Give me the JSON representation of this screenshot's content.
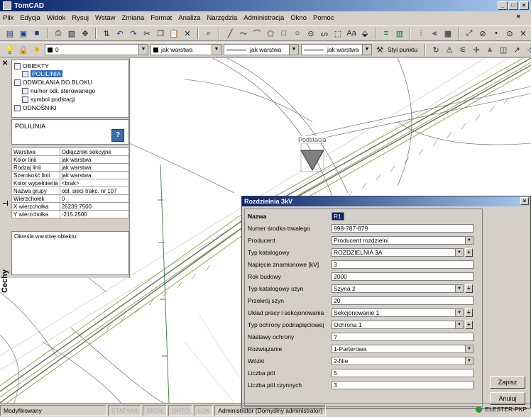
{
  "app": {
    "title": "TomCAD"
  },
  "window_buttons": {
    "minimize": "_",
    "maximize": "□",
    "close": "×"
  },
  "menu": [
    "Plik",
    "Edycja",
    "Widok",
    "Rysuj",
    "Wstaw",
    "Zmiana",
    "Format",
    "Analiza",
    "Narzędzia",
    "Administracja",
    "Okno",
    "Pomoc"
  ],
  "menu_close": "×",
  "toolbar2": {
    "layer_value": "0",
    "color_value": "jak warstwa",
    "linetype_value": "jak warstwa",
    "lineweight_value": "jak warstwa",
    "point_style_label": "Styl punktu"
  },
  "tree": {
    "obiekty": "OBIEKTY",
    "polilinia": "POLILINIA",
    "odwolania": "ODWOŁANIA DO BLOKU",
    "numer": "numer odł. sterowanego",
    "symbol": "symbol podstacji",
    "odnosniki": "ODNOŚNIKI"
  },
  "properties": {
    "object_type": "POLILINIA",
    "help": "?",
    "rows": [
      {
        "key": "Warstwa",
        "value": "Odłączniki sekcyjne"
      },
      {
        "key": "Kolor linii",
        "value": "jak warstwa"
      },
      {
        "key": "Rodzaj linii",
        "value": "jak warstwa"
      },
      {
        "key": "Szerokość linii",
        "value": "jak warstwa"
      },
      {
        "key": "Kolor wypełnienia",
        "value": "<brak>"
      },
      {
        "key": "Nazwa grupy",
        "value": "odł. sieci trakc. nr 107"
      },
      {
        "key": "Wierzchołek",
        "value": "0"
      },
      {
        "key": "X wierzchołka",
        "value": "26239.7500"
      },
      {
        "key": "Y wierzchołka",
        "value": "-215.2500"
      }
    ],
    "description": "Określa warstwę obiektu",
    "pin": "⊣",
    "tab_label": "Cechy"
  },
  "drawing": {
    "substation_label": "Podstacja"
  },
  "dialog": {
    "title": "Rozdzielnia 3kV",
    "close": "×",
    "fields": {
      "nazwa": {
        "label": "Nazwa",
        "value": "R1"
      },
      "numer": {
        "label": "Numer środka trwałego",
        "value": "898-787-879"
      },
      "producent": {
        "label": "Producent",
        "value": "Producent rozdzielni"
      },
      "typ": {
        "label": "Typ katalogowy",
        "value": "ROZDZIELNIA 3A"
      },
      "napiecie": {
        "label": "Napięcie znamionowe [kV]",
        "value": "3"
      },
      "rok": {
        "label": "Rok budowy",
        "value": "2000"
      },
      "typ_szyn": {
        "label": "Typ katalogowy szyn",
        "value": "Szyna 2"
      },
      "przekroj": {
        "label": "Przekrój szyn",
        "value": "20"
      },
      "uklad": {
        "label": "Układ pracy i sekcjonowania",
        "value": "Sekcjonowanie 1"
      },
      "typ_ochrony": {
        "label": "Typ ochrony podnapięciowej",
        "value": "Ochrona 1"
      },
      "nastawy": {
        "label": "Nastawy ochrony",
        "value": "?"
      },
      "rozwiazanie": {
        "label": "Rozwiązanie",
        "value": "1-Parterowa"
      },
      "wozki": {
        "label": "Wózki",
        "value": "2-Nie"
      },
      "liczba_pol": {
        "label": "Liczba pól",
        "value": "5"
      },
      "liczba_pol_czynnych": {
        "label": "Liczba pól czynnych",
        "value": "3"
      }
    },
    "plus": "+",
    "save_label": "Zapisz",
    "cancel_label": "Anuluj"
  },
  "status": {
    "state": "Modyfikowany",
    "statyka": "STATYKA",
    "skok": "SKOK",
    "orto": "ORTO",
    "lok": "LOK",
    "user": "Administrator (Domyślny administrator)",
    "brand": "ELESTER-PKP"
  }
}
